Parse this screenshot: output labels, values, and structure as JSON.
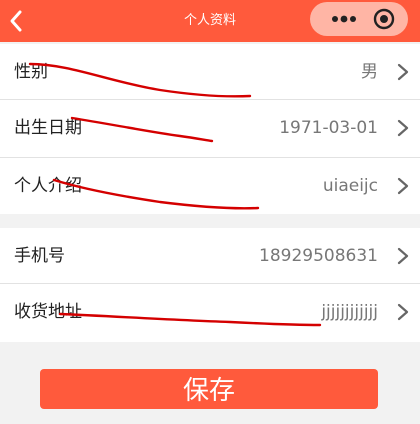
{
  "header": {
    "title": "个人资料",
    "back_icon": "chevron-left-icon",
    "more_icon": "more-dots-icon",
    "target_icon": "target-circle-icon",
    "color": "#ff5a3c"
  },
  "profile": {
    "rows": [
      {
        "label": "性别",
        "value": "男"
      },
      {
        "label": "出生日期",
        "value": "1971-03-01"
      },
      {
        "label": "个人介绍",
        "value": "uiaeijc"
      }
    ]
  },
  "contact": {
    "rows": [
      {
        "label": "手机号",
        "value": "18929508631"
      },
      {
        "label": "收货地址",
        "value": "jjjjjjjjjjjj"
      }
    ]
  },
  "actions": {
    "save_label": "保存"
  }
}
